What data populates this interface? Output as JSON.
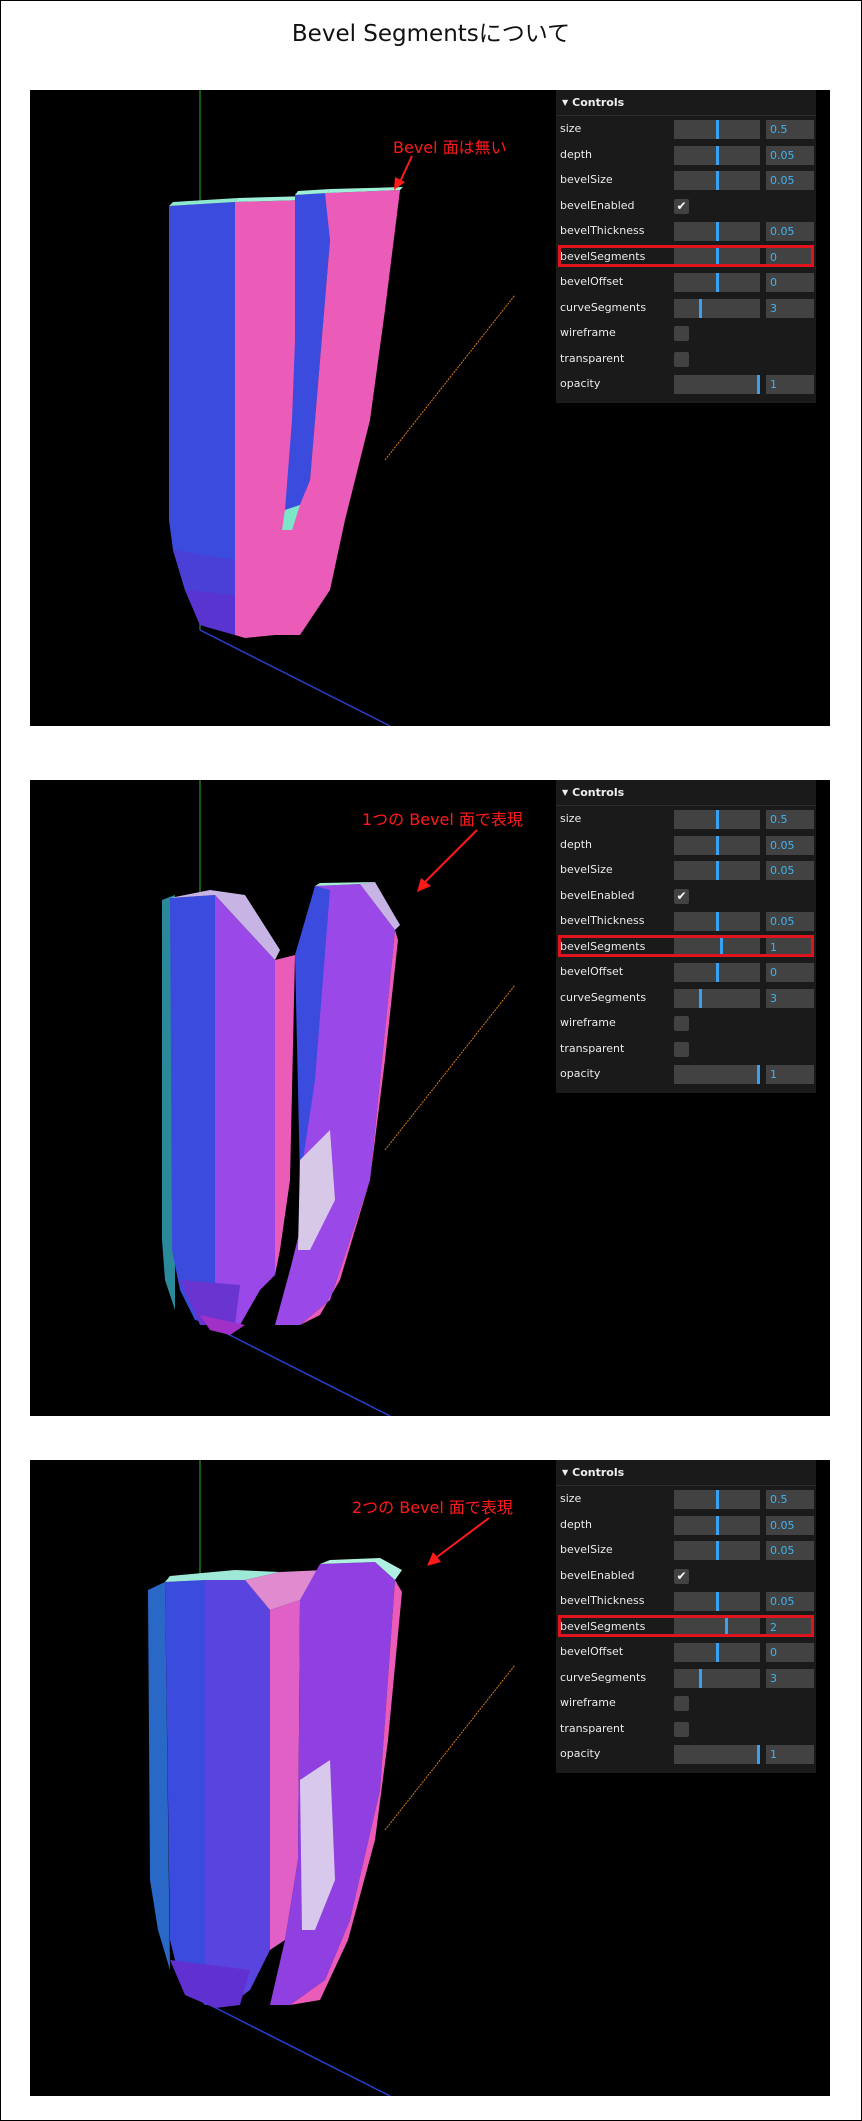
{
  "page": {
    "title": "Bevel Segmentsについて"
  },
  "colors": {
    "highlight": "#e0141e",
    "annotation": "#ff1a1a",
    "value": "#3fb4f0",
    "slider_mark": "#3aa0f0"
  },
  "icons": {
    "folder_toggle": "triangle-down-icon",
    "check": "checkmark-icon",
    "arrow": "red-arrow-icon"
  },
  "panels": [
    {
      "annotation": "Bevel 面は無い",
      "controls": {
        "title": "Controls",
        "rows": [
          {
            "label": "size",
            "type": "slider",
            "value": "0.5",
            "fraction": 0.5
          },
          {
            "label": "depth",
            "type": "slider",
            "value": "0.05",
            "fraction": 0.5
          },
          {
            "label": "bevelSize",
            "type": "slider",
            "value": "0.05",
            "fraction": 0.5
          },
          {
            "label": "bevelEnabled",
            "type": "checkbox",
            "checked": true
          },
          {
            "label": "bevelThickness",
            "type": "slider",
            "value": "0.05",
            "fraction": 0.5
          },
          {
            "label": "bevelSegments",
            "type": "slider",
            "value": "0",
            "fraction": 0.5,
            "highlighted": true
          },
          {
            "label": "bevelOffset",
            "type": "slider",
            "value": "0",
            "fraction": 0.5
          },
          {
            "label": "curveSegments",
            "type": "slider",
            "value": "3",
            "fraction": 0.3
          },
          {
            "label": "wireframe",
            "type": "checkbox",
            "checked": false
          },
          {
            "label": "transparent",
            "type": "checkbox",
            "checked": false
          },
          {
            "label": "opacity",
            "type": "slider",
            "value": "1",
            "fraction": 1.0
          }
        ]
      }
    },
    {
      "annotation": "1つの Bevel 面で表現",
      "controls": {
        "title": "Controls",
        "rows": [
          {
            "label": "size",
            "type": "slider",
            "value": "0.5",
            "fraction": 0.5
          },
          {
            "label": "depth",
            "type": "slider",
            "value": "0.05",
            "fraction": 0.5
          },
          {
            "label": "bevelSize",
            "type": "slider",
            "value": "0.05",
            "fraction": 0.5
          },
          {
            "label": "bevelEnabled",
            "type": "checkbox",
            "checked": true
          },
          {
            "label": "bevelThickness",
            "type": "slider",
            "value": "0.05",
            "fraction": 0.5
          },
          {
            "label": "bevelSegments",
            "type": "slider",
            "value": "1",
            "fraction": 0.55,
            "highlighted": true
          },
          {
            "label": "bevelOffset",
            "type": "slider",
            "value": "0",
            "fraction": 0.5
          },
          {
            "label": "curveSegments",
            "type": "slider",
            "value": "3",
            "fraction": 0.3
          },
          {
            "label": "wireframe",
            "type": "checkbox",
            "checked": false
          },
          {
            "label": "transparent",
            "type": "checkbox",
            "checked": false
          },
          {
            "label": "opacity",
            "type": "slider",
            "value": "1",
            "fraction": 1.0
          }
        ]
      }
    },
    {
      "annotation": "2つの Bevel 面で表現",
      "controls": {
        "title": "Controls",
        "rows": [
          {
            "label": "size",
            "type": "slider",
            "value": "0.5",
            "fraction": 0.5
          },
          {
            "label": "depth",
            "type": "slider",
            "value": "0.05",
            "fraction": 0.5
          },
          {
            "label": "bevelSize",
            "type": "slider",
            "value": "0.05",
            "fraction": 0.5
          },
          {
            "label": "bevelEnabled",
            "type": "checkbox",
            "checked": true
          },
          {
            "label": "bevelThickness",
            "type": "slider",
            "value": "0.05",
            "fraction": 0.5
          },
          {
            "label": "bevelSegments",
            "type": "slider",
            "value": "2",
            "fraction": 0.6,
            "highlighted": true
          },
          {
            "label": "bevelOffset",
            "type": "slider",
            "value": "0",
            "fraction": 0.5
          },
          {
            "label": "curveSegments",
            "type": "slider",
            "value": "3",
            "fraction": 0.3
          },
          {
            "label": "wireframe",
            "type": "checkbox",
            "checked": false
          },
          {
            "label": "transparent",
            "type": "checkbox",
            "checked": false
          },
          {
            "label": "opacity",
            "type": "slider",
            "value": "1",
            "fraction": 1.0
          }
        ]
      }
    }
  ]
}
